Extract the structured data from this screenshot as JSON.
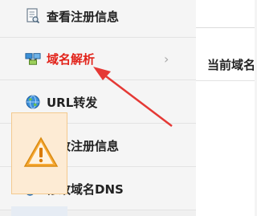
{
  "sidebar": {
    "items": [
      {
        "label": "查看注册信息",
        "icon": "document-view-icon"
      },
      {
        "label": "域名解析",
        "icon": "dns-resolve-icon",
        "active": true
      },
      {
        "label": "URL转发",
        "icon": "globe-icon"
      },
      {
        "label": "修改注册信息",
        "icon": "edit-document-icon"
      },
      {
        "label": "修改域名DNS",
        "icon": "globe-network-icon"
      }
    ],
    "chevron": "›"
  },
  "main": {
    "heading": "当前域名"
  },
  "colors": {
    "active": "#e2231a",
    "warning_bg": "#fdebd4",
    "arrow": "#e53935"
  }
}
